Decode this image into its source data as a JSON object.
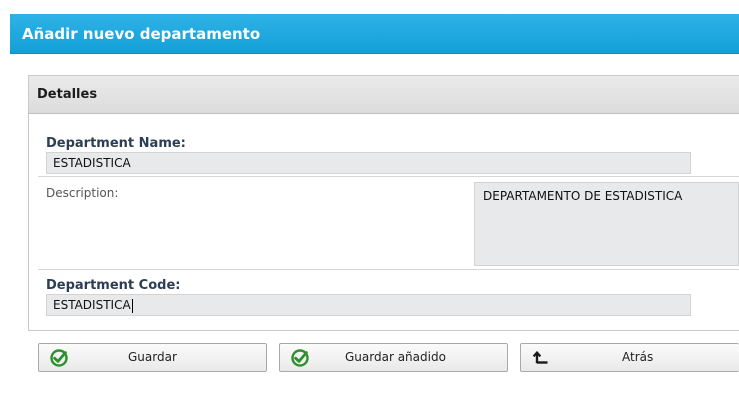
{
  "header": {
    "title": "Añadir nuevo departamento"
  },
  "panel": {
    "title": "Detalles"
  },
  "fields": {
    "department_name": {
      "label": "Department Name:",
      "value": "ESTADISTICA"
    },
    "description": {
      "label": "Description:",
      "value": "DEPARTAMENTO DE ESTADISTICA"
    },
    "department_code": {
      "label": "Department Code:",
      "value": "ESTADISTICA"
    }
  },
  "buttons": {
    "save": "Guardar",
    "save_added": "Guardar añadido",
    "back": "Atrás"
  },
  "colors": {
    "header_bg": "#1aa6dd",
    "accent_icon": "#2f8f2f"
  },
  "icons": {
    "save": "check-circle-icon",
    "save_added": "check-circle-icon",
    "back": "return-arrow-icon"
  }
}
